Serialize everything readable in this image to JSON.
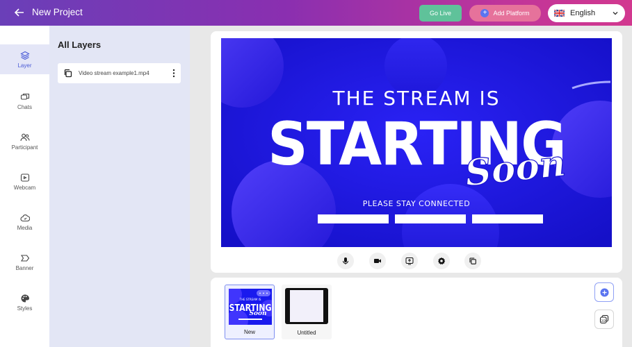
{
  "header": {
    "title": "New Project",
    "go_live_label": "Go Live",
    "add_platform_label": "Add Platform",
    "language": "English"
  },
  "nav": {
    "items": [
      {
        "label": "Layer",
        "icon": "layers-icon"
      },
      {
        "label": "Chats",
        "icon": "chat-icon"
      },
      {
        "label": "Participant",
        "icon": "participants-icon"
      },
      {
        "label": "Webcam",
        "icon": "webcam-icon"
      },
      {
        "label": "Media",
        "icon": "cloud-media-icon"
      },
      {
        "label": "Banner",
        "icon": "banner-icon"
      },
      {
        "label": "Styles",
        "icon": "palette-icon"
      }
    ]
  },
  "layers": {
    "title": "All Layers",
    "items": [
      {
        "name": "Video stream example1.mp4"
      }
    ]
  },
  "stage": {
    "line1": "THE STREAM IS",
    "line2": "STARTING",
    "line3": "Soon",
    "line4": "PLEASE STAY CONNECTED"
  },
  "scenes": {
    "items": [
      {
        "label": "New",
        "thumb_line1": "THE STREAM IS",
        "thumb_line2": "STARTING",
        "thumb_line3": "Soon"
      },
      {
        "label": "Untitled"
      }
    ]
  },
  "colors": {
    "accent": "#4a5bd6",
    "go_live": "#5fc29a",
    "add_platform": "#e6729b",
    "stage_blue": "#1a1aee"
  }
}
